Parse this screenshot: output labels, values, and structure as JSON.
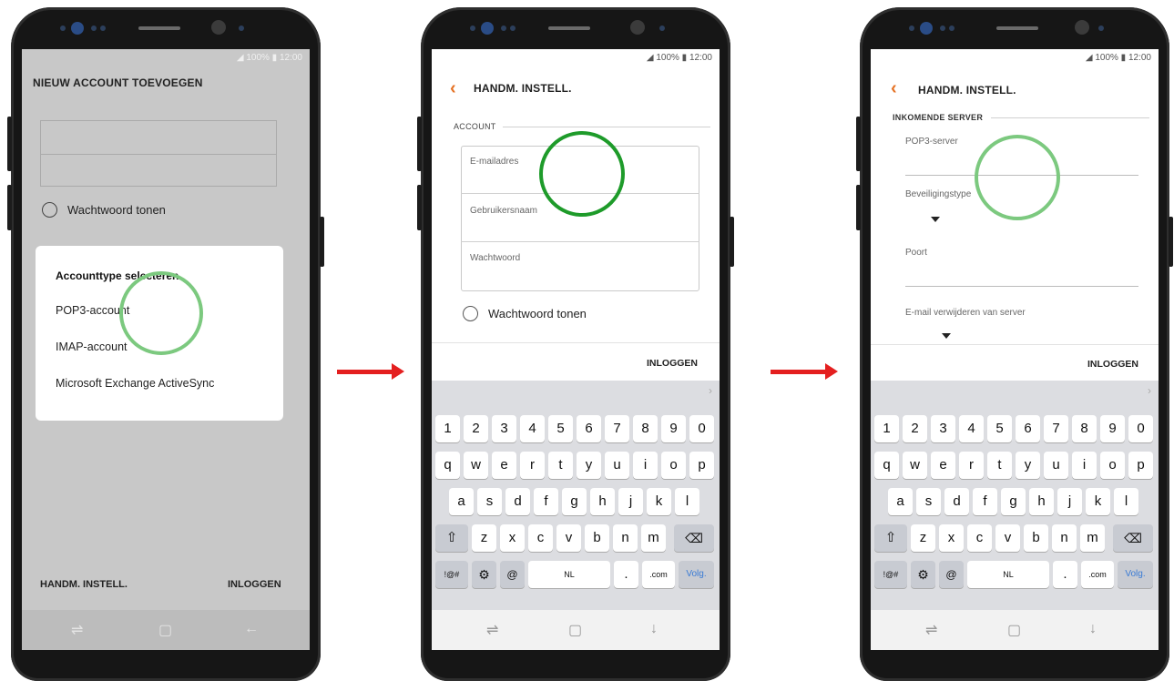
{
  "status_bar": "◢ 100% ▮ 12:00",
  "phone1": {
    "title": "NIEUW ACCOUNT TOEVOEGEN",
    "show_password": "Wachtwoord tonen",
    "dialog": {
      "heading": "Accounttype selecteren",
      "options": [
        "POP3-account",
        "IMAP-account",
        "Microsoft Exchange ActiveSync"
      ]
    },
    "manual_settings": "HANDM. INSTELL.",
    "login": "INLOGGEN"
  },
  "phone2": {
    "title": "HANDM. INSTELL.",
    "section": "ACCOUNT",
    "fields": [
      "E-mailadres",
      "Gebruikersnaam",
      "Wachtwoord"
    ],
    "show_password": "Wachtwoord tonen",
    "login": "INLOGGEN"
  },
  "phone3": {
    "title": "HANDM. INSTELL.",
    "section": "INKOMENDE SERVER",
    "fields": [
      "POP3-server",
      "Beveiligingstype",
      "Poort",
      "E-mail verwijderen van server"
    ],
    "login": "INLOGGEN"
  },
  "keyboard": {
    "row1": [
      "1",
      "2",
      "3",
      "4",
      "5",
      "6",
      "7",
      "8",
      "9",
      "0"
    ],
    "row2": [
      "q",
      "w",
      "e",
      "r",
      "t",
      "y",
      "u",
      "i",
      "o",
      "p"
    ],
    "row3": [
      "a",
      "s",
      "d",
      "f",
      "g",
      "h",
      "j",
      "k",
      "l"
    ],
    "row4": [
      "⇧",
      "z",
      "x",
      "c",
      "v",
      "b",
      "n",
      "m",
      "⌫"
    ],
    "row5": [
      "!@#",
      "⚙",
      "@",
      "NL",
      ".",
      ".com",
      "Volg."
    ]
  },
  "icons": {
    "back": "‹",
    "recent": "⇌",
    "home": "▢",
    "nav_back": "←",
    "hide_keyboard": "↓",
    "chevron": "›"
  },
  "colors": {
    "accent": "#e57225",
    "highlight_circle": "#1e9b2a",
    "highlight_circle_faded": "#7cc97f",
    "arrow": "#e41f1f"
  }
}
